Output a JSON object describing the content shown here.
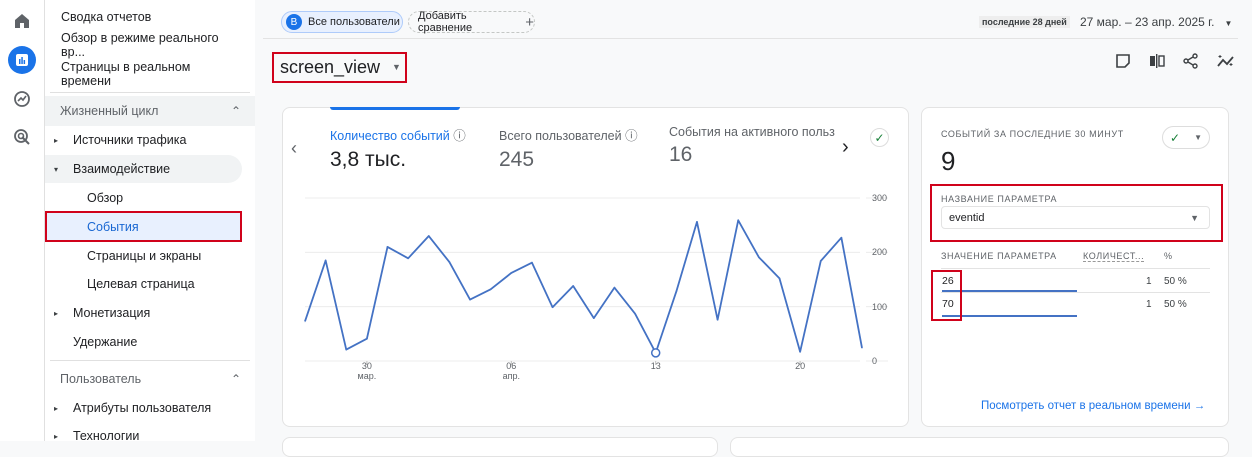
{
  "sidebar": {
    "top_items": [
      "Сводка отчетов",
      "Обзор в режиме реального вр...",
      "Страницы в реальном времени"
    ],
    "section1": "Жизненный цикл",
    "items1": [
      {
        "label": "Источники трафика",
        "arrow": "▸"
      },
      {
        "label": "Взаимодействие",
        "arrow": "▾"
      },
      {
        "label": "Обзор"
      },
      {
        "label": "События"
      },
      {
        "label": "Страницы и экраны"
      },
      {
        "label": "Целевая страница"
      },
      {
        "label": "Монетизация",
        "arrow": "▸"
      },
      {
        "label": "Удержание"
      }
    ],
    "section2": "Пользователь",
    "items2": [
      {
        "label": "Атрибуты пользователя",
        "arrow": "▸"
      },
      {
        "label": "Технологии",
        "arrow": "▸"
      }
    ]
  },
  "header": {
    "segment_letter": "B",
    "segment": "Все пользователи",
    "add_comparison": "Добавить сравнение",
    "date_badge": "последние 28 дней",
    "date_range": "27 мар. – 23 апр. 2025 г.",
    "event_name": "screen_view"
  },
  "metrics": [
    {
      "label": "Количество событий",
      "value": "3,8 тыс."
    },
    {
      "label": "Всего пользователей",
      "value": "245"
    },
    {
      "label": "События на активного пользов",
      "value": "16"
    }
  ],
  "colors": {
    "accent": "#1a73e8",
    "line": "#4472c4",
    "highlight": "#d0021b",
    "success": "#188038"
  },
  "chart_data": {
    "type": "line",
    "x": [
      "27 мар.",
      "28 мар.",
      "29 мар.",
      "30 мар.",
      "31 мар.",
      "1 апр.",
      "2 апр.",
      "3 апр.",
      "4 апр.",
      "5 апр.",
      "6 апр.",
      "7 апр.",
      "8 апр.",
      "9 апр.",
      "10 апр.",
      "11 апр.",
      "12 апр.",
      "13 апр.",
      "14 апр.",
      "15 апр.",
      "16 апр.",
      "17 апр.",
      "18 апр.",
      "19 апр.",
      "20 апр.",
      "21 апр.",
      "22 апр.",
      "23 апр."
    ],
    "values": [
      73,
      185,
      21,
      41,
      210,
      189,
      230,
      182,
      113,
      132,
      162,
      181,
      99,
      138,
      79,
      135,
      87,
      15,
      128,
      256,
      76,
      259,
      191,
      152,
      17,
      184,
      227,
      24
    ],
    "ylim": [
      0,
      300
    ],
    "yticks": [
      "0",
      "100",
      "200",
      "300"
    ],
    "xticks": [
      {
        "index": 3,
        "day": "30",
        "month": "мар."
      },
      {
        "index": 10,
        "day": "06",
        "month": "апр."
      },
      {
        "index": 17,
        "day": "13",
        "month": ""
      },
      {
        "index": 24,
        "day": "20",
        "month": ""
      }
    ],
    "highlighted_index": 17,
    "grid": true
  },
  "realtime": {
    "title": "СОБЫТИЙ ЗА ПОСЛЕДНИЕ 30 МИНУТ",
    "value": "9",
    "param_label": "НАЗВАНИЕ ПАРАМЕТРА",
    "param_value": "eventid",
    "columns": [
      "ЗНАЧЕНИЕ ПАРАМЕТРА",
      "КОЛИЧЕСТ...",
      "%"
    ],
    "rows": [
      {
        "value": "26",
        "count": "1",
        "pct": "50 %",
        "share": 0.5
      },
      {
        "value": "70",
        "count": "1",
        "pct": "50 %",
        "share": 0.5
      }
    ],
    "link": "Посмотреть отчет в реальном времени"
  }
}
